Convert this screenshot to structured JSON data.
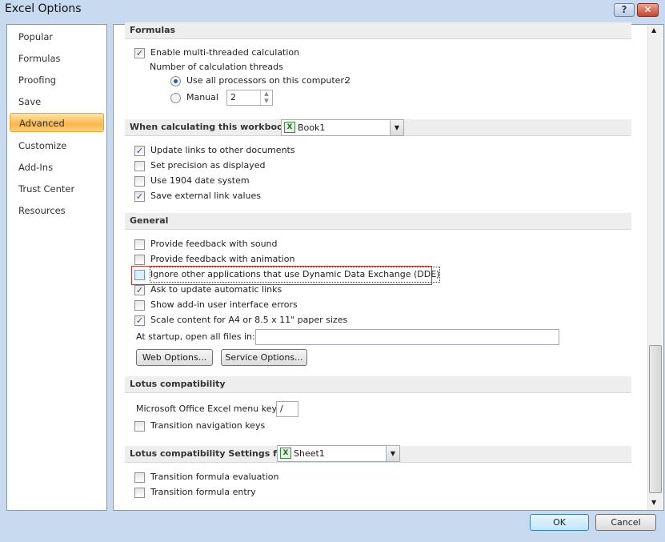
{
  "window": {
    "title": "Excel Options",
    "help": "?",
    "close": "✕"
  },
  "sidebar": {
    "items": [
      {
        "label": "Popular"
      },
      {
        "label": "Formulas"
      },
      {
        "label": "Proofing"
      },
      {
        "label": "Save"
      },
      {
        "label": "Advanced",
        "selected": true
      },
      {
        "label": "Customize"
      },
      {
        "label": "Add-Ins"
      },
      {
        "label": "Trust Center"
      },
      {
        "label": "Resources"
      }
    ]
  },
  "formulas": {
    "header": "Formulas",
    "enable_mt": {
      "label": "Enable multi-threaded calculation",
      "checked": true
    },
    "threads_label": "Number of calculation threads",
    "use_all": {
      "label": "Use all processors on this computer:",
      "value": "2",
      "selected": true
    },
    "manual": {
      "label": "Manual",
      "value": "2",
      "selected": false
    }
  },
  "workbook_calc": {
    "header": "When calculating this workbook:",
    "workbook": "Book1",
    "items": [
      {
        "label": "Update links to other documents",
        "checked": true
      },
      {
        "label": "Set precision as displayed",
        "checked": false
      },
      {
        "label": "Use 1904 date system",
        "checked": false
      },
      {
        "label": "Save external link values",
        "checked": true
      }
    ]
  },
  "general": {
    "header": "General",
    "items": [
      {
        "label": "Provide feedback with sound",
        "checked": false
      },
      {
        "label": "Provide feedback with animation",
        "checked": false
      },
      {
        "label": "Ignore other applications that use Dynamic Data Exchange (DDE)",
        "checked": false
      },
      {
        "label": "Ask to update automatic links",
        "checked": true
      },
      {
        "label": "Show add-in user interface errors",
        "checked": false
      },
      {
        "label": "Scale content for A4 or 8.5 x 11\" paper sizes",
        "checked": true
      }
    ],
    "startup_label": "At startup, open all files in:",
    "startup_value": "",
    "web_options": "Web Options...",
    "service_options": "Service Options..."
  },
  "lotus": {
    "header": "Lotus compatibility",
    "menu_key_label": "Microsoft Office Excel menu key:",
    "menu_key_value": "/",
    "nav_keys": {
      "label": "Transition navigation keys",
      "checked": false
    }
  },
  "lotus_settings": {
    "header": "Lotus compatibility Settings for:",
    "sheet": "Sheet1",
    "items": [
      {
        "label": "Transition formula evaluation",
        "checked": false
      },
      {
        "label": "Transition formula entry",
        "checked": false
      }
    ]
  },
  "footer": {
    "ok": "OK",
    "cancel": "Cancel"
  },
  "colors": {
    "selected_nav": "#f9b54c",
    "highlight_box": "#c0392b"
  }
}
